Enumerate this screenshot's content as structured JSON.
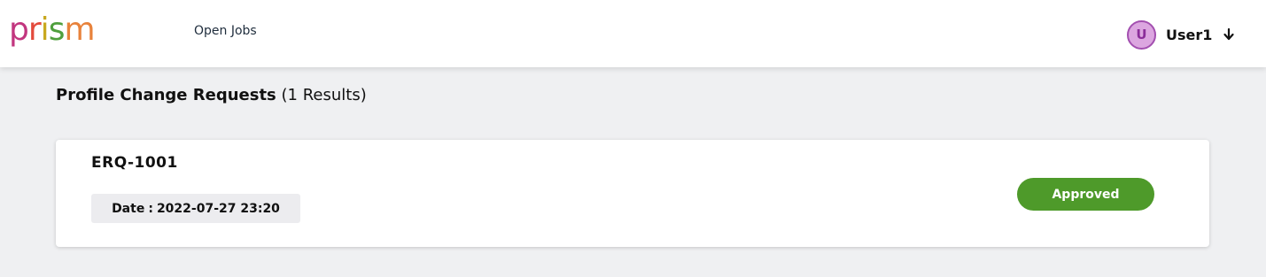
{
  "header": {
    "logo_letters": [
      {
        "ch": "p",
        "color": "#c2367f"
      },
      {
        "ch": "r",
        "color": "#e34a3c"
      },
      {
        "ch": "i",
        "color": "#c8a81f"
      },
      {
        "ch": "s",
        "color": "#4f9f3d"
      },
      {
        "ch": "m",
        "color": "#e8823b"
      }
    ],
    "nav": {
      "open_jobs": "Open Jobs"
    },
    "user": {
      "avatar_initial": "U",
      "name": "User1",
      "menu_icon": "arrow-down-icon"
    }
  },
  "main": {
    "heading": {
      "title": "Profile Change Requests",
      "count": "(1 Results)"
    },
    "requests": [
      {
        "id": "ERQ-1001",
        "date_label": "Date",
        "date_sep": ":",
        "date_value": "2022-07-27 23:20",
        "status": "Approved",
        "status_color": "#4e9a2a"
      }
    ]
  }
}
